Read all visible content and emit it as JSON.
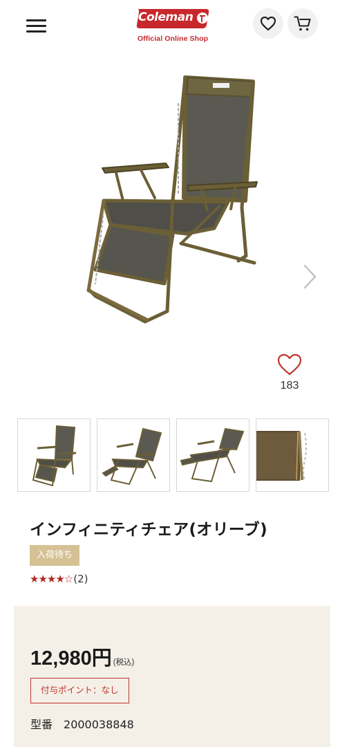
{
  "header": {
    "menu_icon": "hamburger-menu-icon",
    "logo_text": "Coleman",
    "logo_subtitle": "Official Online Shop",
    "favorites_icon": "heart-icon",
    "cart_icon": "cart-icon"
  },
  "gallery": {
    "next_icon": "chevron-right-icon",
    "like_count": "183",
    "thumbnail_count": 4
  },
  "product": {
    "title": "インフィニティチェア(オリーブ)",
    "status_badge": "入荷待ち",
    "rating_stars": "★★★★",
    "rating_empty_star": "☆",
    "rating_count": "(2)",
    "rating_value": 4
  },
  "pricing": {
    "price": "12,980円",
    "tax_note": "(税込)",
    "points_label": "付与ポイント：なし",
    "model_label": "型番",
    "model_number": "2000038848"
  },
  "colors": {
    "brand_red": "#c8282c",
    "badge_gold": "#d6c195",
    "panel_beige": "#f4efe7",
    "olive": "#6b5f36"
  }
}
